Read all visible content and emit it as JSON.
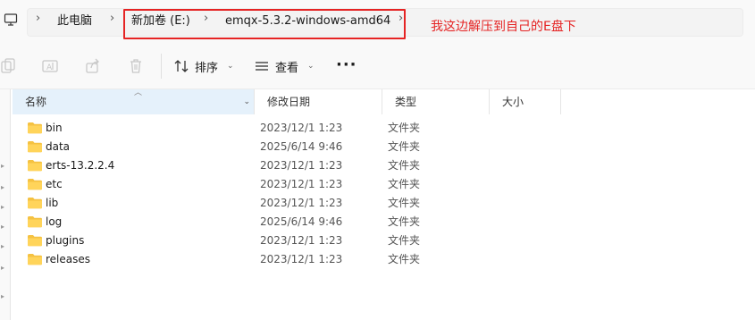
{
  "address": {
    "crumbs": [
      "此电脑",
      "新加卷 (E:)",
      "emqx-5.3.2-windows-amd64"
    ],
    "annotation": "我这边解压到自己的E盘下"
  },
  "toolbar": {
    "sort_label": "排序",
    "view_label": "查看",
    "more_label": "···"
  },
  "columns": {
    "name": "名称",
    "date": "修改日期",
    "type": "类型",
    "size": "大小"
  },
  "files": [
    {
      "name": "bin",
      "date": "2023/12/1 1:23",
      "type": "文件夹"
    },
    {
      "name": "data",
      "date": "2025/6/14 9:46",
      "type": "文件夹"
    },
    {
      "name": "erts-13.2.2.4",
      "date": "2023/12/1 1:23",
      "type": "文件夹"
    },
    {
      "name": "etc",
      "date": "2023/12/1 1:23",
      "type": "文件夹"
    },
    {
      "name": "lib",
      "date": "2023/12/1 1:23",
      "type": "文件夹"
    },
    {
      "name": "log",
      "date": "2025/6/14 9:46",
      "type": "文件夹"
    },
    {
      "name": "plugins",
      "date": "2023/12/1 1:23",
      "type": "文件夹"
    },
    {
      "name": "releases",
      "date": "2023/12/1 1:23",
      "type": "文件夹"
    }
  ],
  "colors": {
    "annotation": "#e52424",
    "folder": "#f5c242",
    "header_selected": "#e5f1fb"
  }
}
